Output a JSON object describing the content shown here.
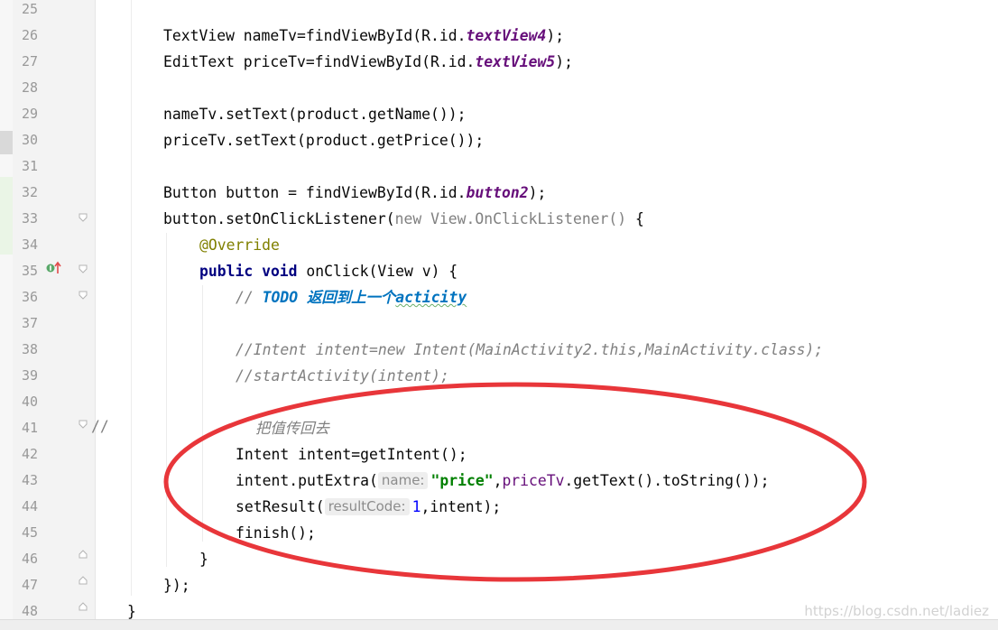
{
  "editor": {
    "lines": [
      {
        "num": "25",
        "segs": []
      },
      {
        "num": "26",
        "segs": [
          {
            "t": "TextView nameTv=findViewById(R.id."
          },
          {
            "t": "textView4",
            "c": "id"
          },
          {
            "t": ");"
          }
        ]
      },
      {
        "num": "27",
        "segs": [
          {
            "t": "EditText priceTv=findViewById(R.id."
          },
          {
            "t": "textView5",
            "c": "id"
          },
          {
            "t": ");"
          }
        ]
      },
      {
        "num": "28",
        "segs": []
      },
      {
        "num": "29",
        "segs": [
          {
            "t": "nameTv.setText(product.getName());"
          }
        ]
      },
      {
        "num": "30",
        "segs": [
          {
            "t": "priceTv.setText(product.getPrice());"
          }
        ]
      },
      {
        "num": "31",
        "segs": []
      },
      {
        "num": "32",
        "segs": [
          {
            "t": "Button button = findViewById(R.id."
          },
          {
            "t": "button2",
            "c": "id"
          },
          {
            "t": ");"
          }
        ]
      },
      {
        "num": "33",
        "segs": [
          {
            "t": "button.setOnClickListener("
          },
          {
            "t": "new ",
            "c": "gray"
          },
          {
            "t": "View.OnClickListener() ",
            "c": "gray"
          },
          {
            "t": "{"
          }
        ]
      },
      {
        "num": "34",
        "segs": [
          {
            "t": "@Override",
            "c": "ann"
          }
        ]
      },
      {
        "num": "35",
        "segs": [
          {
            "t": "public void ",
            "c": "kw"
          },
          {
            "t": "onClick(View v) {"
          }
        ]
      },
      {
        "num": "36",
        "segs": [
          {
            "t": "// ",
            "c": "cmt"
          },
          {
            "t": "TODO ",
            "c": "todo"
          },
          {
            "t": "返回到上一个",
            "c": "todo"
          },
          {
            "t": "acticity",
            "c": "todo squig"
          }
        ]
      },
      {
        "num": "37",
        "segs": []
      },
      {
        "num": "38",
        "segs": [
          {
            "t": "//Intent intent=new Intent(MainActivity2.this,MainActivity.class);",
            "c": "cmt"
          }
        ]
      },
      {
        "num": "39",
        "segs": [
          {
            "t": "//startActivity(intent);",
            "c": "cmt"
          }
        ]
      },
      {
        "num": "40",
        "segs": []
      },
      {
        "num": "41",
        "segs": [
          {
            "t": "把值传回去",
            "c": "cmt"
          }
        ]
      },
      {
        "num": "42",
        "segs": [
          {
            "t": "Intent intent=getIntent();"
          }
        ]
      },
      {
        "num": "43",
        "segs": [
          {
            "t": "intent.putExtra("
          },
          {
            "t": "name:",
            "c": "hint"
          },
          {
            "t": "\"price\"",
            "c": "str"
          },
          {
            "t": ","
          },
          {
            "t": "priceTv",
            "c": "ref"
          },
          {
            "t": ".getText().toString());"
          }
        ]
      },
      {
        "num": "44",
        "segs": [
          {
            "t": "setResult("
          },
          {
            "t": "resultCode:",
            "c": "hint"
          },
          {
            "t": "1",
            "c": "num"
          },
          {
            "t": ",intent);"
          }
        ]
      },
      {
        "num": "45",
        "segs": [
          {
            "t": "finish();"
          }
        ]
      },
      {
        "num": "46",
        "segs": [
          {
            "t": "}"
          }
        ]
      },
      {
        "num": "47",
        "segs": [
          {
            "t": "});"
          }
        ]
      },
      {
        "num": "48",
        "segs": [
          {
            "t": "}"
          }
        ]
      }
    ],
    "line41_prefix": "//"
  },
  "watermark": "https://blog.csdn.net/ladiez",
  "colors": {
    "annotation_circle": "#e8363a",
    "gutter_change_marker": "#eaf5e6",
    "gutter_modified_marker": "#d9d9d9",
    "override_marker": "#59a869",
    "override_arrow": "#e14b4b"
  },
  "icons": [
    "fold-start-icon",
    "fold-end-icon",
    "override-method-icon"
  ]
}
